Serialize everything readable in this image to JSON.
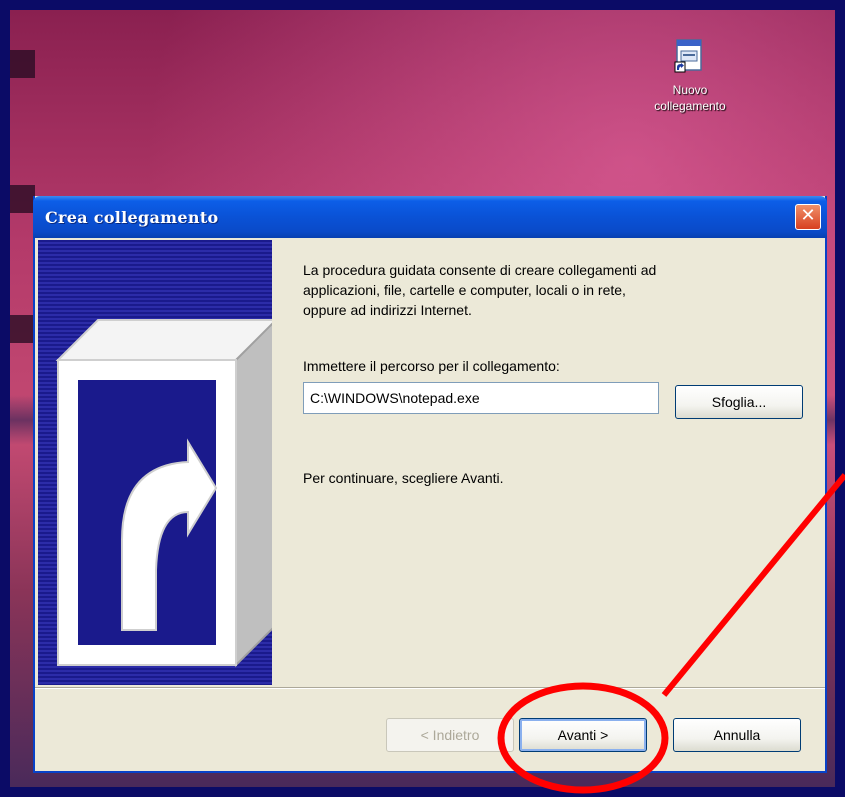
{
  "desktop": {
    "icon_label_line1": "Nuovo",
    "icon_label_line2": "collegamento",
    "icon_name": "shortcut-file-icon"
  },
  "dialog": {
    "title": "Crea collegamento",
    "close_label": "✕",
    "intro_line1": "La procedura guidata consente di creare collegamenti ad",
    "intro_line2": "applicazioni, file, cartelle e computer, locali o in rete,",
    "intro_line3": "oppure ad indirizzi Internet.",
    "path_label": "Immettere il percorso per il collegamento:",
    "path_value": "C:\\WINDOWS\\notepad.exe",
    "browse_label": "Sfoglia...",
    "continue_hint": "Per continuare, scegliere Avanti.",
    "buttons": {
      "back": "< Indietro",
      "next": "Avanti >",
      "cancel": "Annulla"
    }
  },
  "colors": {
    "frame": "#0b0b66",
    "titlebar": "#0a52d6",
    "annotation": "#ff0000",
    "dialog_bg": "#ece9d8"
  }
}
